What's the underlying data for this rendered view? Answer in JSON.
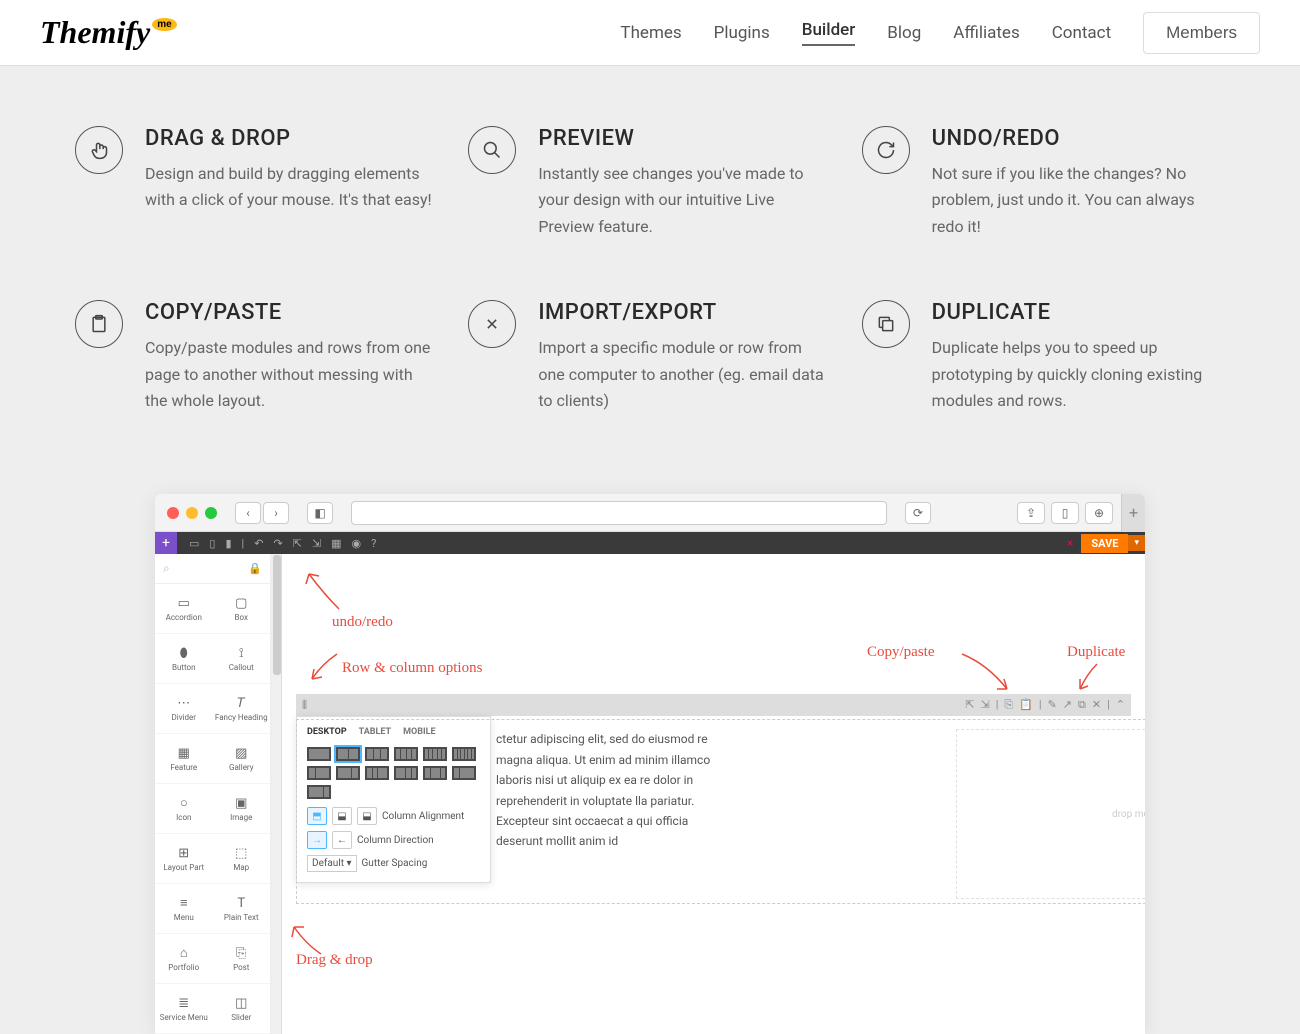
{
  "brand": {
    "name": "Themify",
    "badge": "me"
  },
  "nav": {
    "items": [
      "Themes",
      "Plugins",
      "Builder",
      "Blog",
      "Affiliates",
      "Contact"
    ],
    "active": "Builder",
    "members": "Members"
  },
  "features": [
    {
      "title": "DRAG & DROP",
      "desc": "Design and build by dragging elements with a click of your mouse. It's that easy!",
      "icon": "hand"
    },
    {
      "title": "PREVIEW",
      "desc": "Instantly see changes you've made to your design with our intuitive Live Preview feature.",
      "icon": "search"
    },
    {
      "title": "UNDO/REDO",
      "desc": "Not sure if you like the changes? No problem, just undo it. You can always redo it!",
      "icon": "refresh"
    },
    {
      "title": "COPY/PASTE",
      "desc": "Copy/paste modules and rows from one page to another without messing with the whole layout.",
      "icon": "clipboard"
    },
    {
      "title": "IMPORT/EXPORT",
      "desc": "Import a specific module or row from one computer to another (eg. email data to clients)",
      "icon": "transfer"
    },
    {
      "title": "DUPLICATE",
      "desc": "Duplicate helps you to speed up prototyping by quickly cloning existing modules and rows.",
      "icon": "duplicate"
    }
  ],
  "screenshot": {
    "toolbar": {
      "save": "SAVE"
    },
    "annotations": {
      "undo": "undo/redo",
      "rowcol": "Row & column options",
      "copy": "Copy/paste",
      "dup": "Duplicate",
      "drag": "Drag & drop"
    },
    "modules": [
      "Accordion",
      "Box",
      "Button",
      "Callout",
      "Divider",
      "Fancy Heading",
      "Feature",
      "Gallery",
      "Icon",
      "Image",
      "Layout Part",
      "Map",
      "Menu",
      "Plain Text",
      "Portfolio",
      "Post",
      "Service Menu",
      "Slider"
    ],
    "popover": {
      "tabs": [
        "DESKTOP",
        "TABLET",
        "MOBILE"
      ],
      "colAlign": "Column Alignment",
      "colDir": "Column Direction",
      "gutter": "Gutter Spacing",
      "gutterDefault": "Default"
    },
    "lorem": "ctetur adipiscing elit, sed do eiusmod re magna aliqua. Ut enim ad minim illamco laboris nisi ut aliquip ex ea re dolor in reprehenderit in voluptate lla pariatur. Excepteur sint occaecat a qui officia deserunt mollit anim id",
    "dropzone": "drop module here"
  }
}
